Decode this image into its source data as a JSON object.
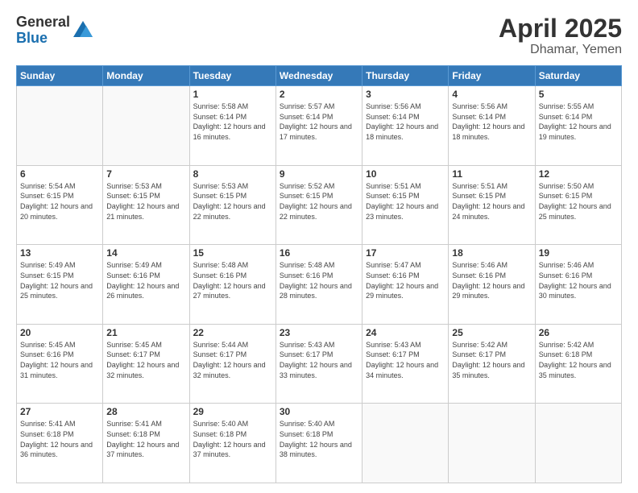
{
  "header": {
    "logo_general": "General",
    "logo_blue": "Blue",
    "title": "April 2025",
    "location": "Dhamar, Yemen"
  },
  "days_of_week": [
    "Sunday",
    "Monday",
    "Tuesday",
    "Wednesday",
    "Thursday",
    "Friday",
    "Saturday"
  ],
  "weeks": [
    [
      {
        "day": "",
        "info": ""
      },
      {
        "day": "",
        "info": ""
      },
      {
        "day": "1",
        "info": "Sunrise: 5:58 AM\nSunset: 6:14 PM\nDaylight: 12 hours and 16 minutes."
      },
      {
        "day": "2",
        "info": "Sunrise: 5:57 AM\nSunset: 6:14 PM\nDaylight: 12 hours and 17 minutes."
      },
      {
        "day": "3",
        "info": "Sunrise: 5:56 AM\nSunset: 6:14 PM\nDaylight: 12 hours and 18 minutes."
      },
      {
        "day": "4",
        "info": "Sunrise: 5:56 AM\nSunset: 6:14 PM\nDaylight: 12 hours and 18 minutes."
      },
      {
        "day": "5",
        "info": "Sunrise: 5:55 AM\nSunset: 6:14 PM\nDaylight: 12 hours and 19 minutes."
      }
    ],
    [
      {
        "day": "6",
        "info": "Sunrise: 5:54 AM\nSunset: 6:15 PM\nDaylight: 12 hours and 20 minutes."
      },
      {
        "day": "7",
        "info": "Sunrise: 5:53 AM\nSunset: 6:15 PM\nDaylight: 12 hours and 21 minutes."
      },
      {
        "day": "8",
        "info": "Sunrise: 5:53 AM\nSunset: 6:15 PM\nDaylight: 12 hours and 22 minutes."
      },
      {
        "day": "9",
        "info": "Sunrise: 5:52 AM\nSunset: 6:15 PM\nDaylight: 12 hours and 22 minutes."
      },
      {
        "day": "10",
        "info": "Sunrise: 5:51 AM\nSunset: 6:15 PM\nDaylight: 12 hours and 23 minutes."
      },
      {
        "day": "11",
        "info": "Sunrise: 5:51 AM\nSunset: 6:15 PM\nDaylight: 12 hours and 24 minutes."
      },
      {
        "day": "12",
        "info": "Sunrise: 5:50 AM\nSunset: 6:15 PM\nDaylight: 12 hours and 25 minutes."
      }
    ],
    [
      {
        "day": "13",
        "info": "Sunrise: 5:49 AM\nSunset: 6:15 PM\nDaylight: 12 hours and 25 minutes."
      },
      {
        "day": "14",
        "info": "Sunrise: 5:49 AM\nSunset: 6:16 PM\nDaylight: 12 hours and 26 minutes."
      },
      {
        "day": "15",
        "info": "Sunrise: 5:48 AM\nSunset: 6:16 PM\nDaylight: 12 hours and 27 minutes."
      },
      {
        "day": "16",
        "info": "Sunrise: 5:48 AM\nSunset: 6:16 PM\nDaylight: 12 hours and 28 minutes."
      },
      {
        "day": "17",
        "info": "Sunrise: 5:47 AM\nSunset: 6:16 PM\nDaylight: 12 hours and 29 minutes."
      },
      {
        "day": "18",
        "info": "Sunrise: 5:46 AM\nSunset: 6:16 PM\nDaylight: 12 hours and 29 minutes."
      },
      {
        "day": "19",
        "info": "Sunrise: 5:46 AM\nSunset: 6:16 PM\nDaylight: 12 hours and 30 minutes."
      }
    ],
    [
      {
        "day": "20",
        "info": "Sunrise: 5:45 AM\nSunset: 6:16 PM\nDaylight: 12 hours and 31 minutes."
      },
      {
        "day": "21",
        "info": "Sunrise: 5:45 AM\nSunset: 6:17 PM\nDaylight: 12 hours and 32 minutes."
      },
      {
        "day": "22",
        "info": "Sunrise: 5:44 AM\nSunset: 6:17 PM\nDaylight: 12 hours and 32 minutes."
      },
      {
        "day": "23",
        "info": "Sunrise: 5:43 AM\nSunset: 6:17 PM\nDaylight: 12 hours and 33 minutes."
      },
      {
        "day": "24",
        "info": "Sunrise: 5:43 AM\nSunset: 6:17 PM\nDaylight: 12 hours and 34 minutes."
      },
      {
        "day": "25",
        "info": "Sunrise: 5:42 AM\nSunset: 6:17 PM\nDaylight: 12 hours and 35 minutes."
      },
      {
        "day": "26",
        "info": "Sunrise: 5:42 AM\nSunset: 6:18 PM\nDaylight: 12 hours and 35 minutes."
      }
    ],
    [
      {
        "day": "27",
        "info": "Sunrise: 5:41 AM\nSunset: 6:18 PM\nDaylight: 12 hours and 36 minutes."
      },
      {
        "day": "28",
        "info": "Sunrise: 5:41 AM\nSunset: 6:18 PM\nDaylight: 12 hours and 37 minutes."
      },
      {
        "day": "29",
        "info": "Sunrise: 5:40 AM\nSunset: 6:18 PM\nDaylight: 12 hours and 37 minutes."
      },
      {
        "day": "30",
        "info": "Sunrise: 5:40 AM\nSunset: 6:18 PM\nDaylight: 12 hours and 38 minutes."
      },
      {
        "day": "",
        "info": ""
      },
      {
        "day": "",
        "info": ""
      },
      {
        "day": "",
        "info": ""
      }
    ]
  ]
}
